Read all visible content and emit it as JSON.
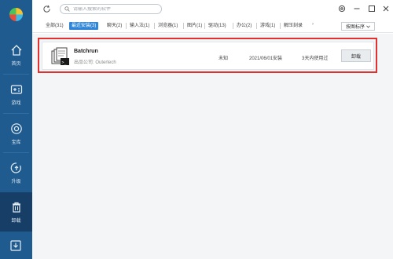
{
  "sidebar": {
    "items": [
      {
        "label": "首页",
        "icon": "home-icon"
      },
      {
        "label": "游戏",
        "icon": "gamepad-icon"
      },
      {
        "label": "宝库",
        "icon": "treasure-icon"
      },
      {
        "label": "升级",
        "icon": "upgrade-icon"
      },
      {
        "label": "卸载",
        "icon": "trash-icon"
      }
    ],
    "active": "卸载"
  },
  "search": {
    "placeholder": "请输入搜索的软件"
  },
  "tabs": [
    {
      "label": "全部(31)"
    },
    {
      "label": "最近安装(3)",
      "active": true
    },
    {
      "label": "聊天(2)"
    },
    {
      "label": "输入法(1)"
    },
    {
      "label": "浏览器(1)"
    },
    {
      "label": "图片(1)"
    },
    {
      "label": "驱动(13)"
    },
    {
      "label": "办公(2)"
    },
    {
      "label": "游戏(1)"
    },
    {
      "label": "解压刻录"
    }
  ],
  "sort_button": {
    "label": "按图标序"
  },
  "apps": [
    {
      "name": "Batchrun",
      "publisher": "出品公司: Outertech",
      "size": "未知",
      "install_date": "2021/06/01安装",
      "last_used": "3天内使用过",
      "action": "卸载"
    }
  ],
  "colors": {
    "sidebar": "#1f5b8f",
    "accent": "#2f86d6",
    "highlight": "#e03030"
  }
}
